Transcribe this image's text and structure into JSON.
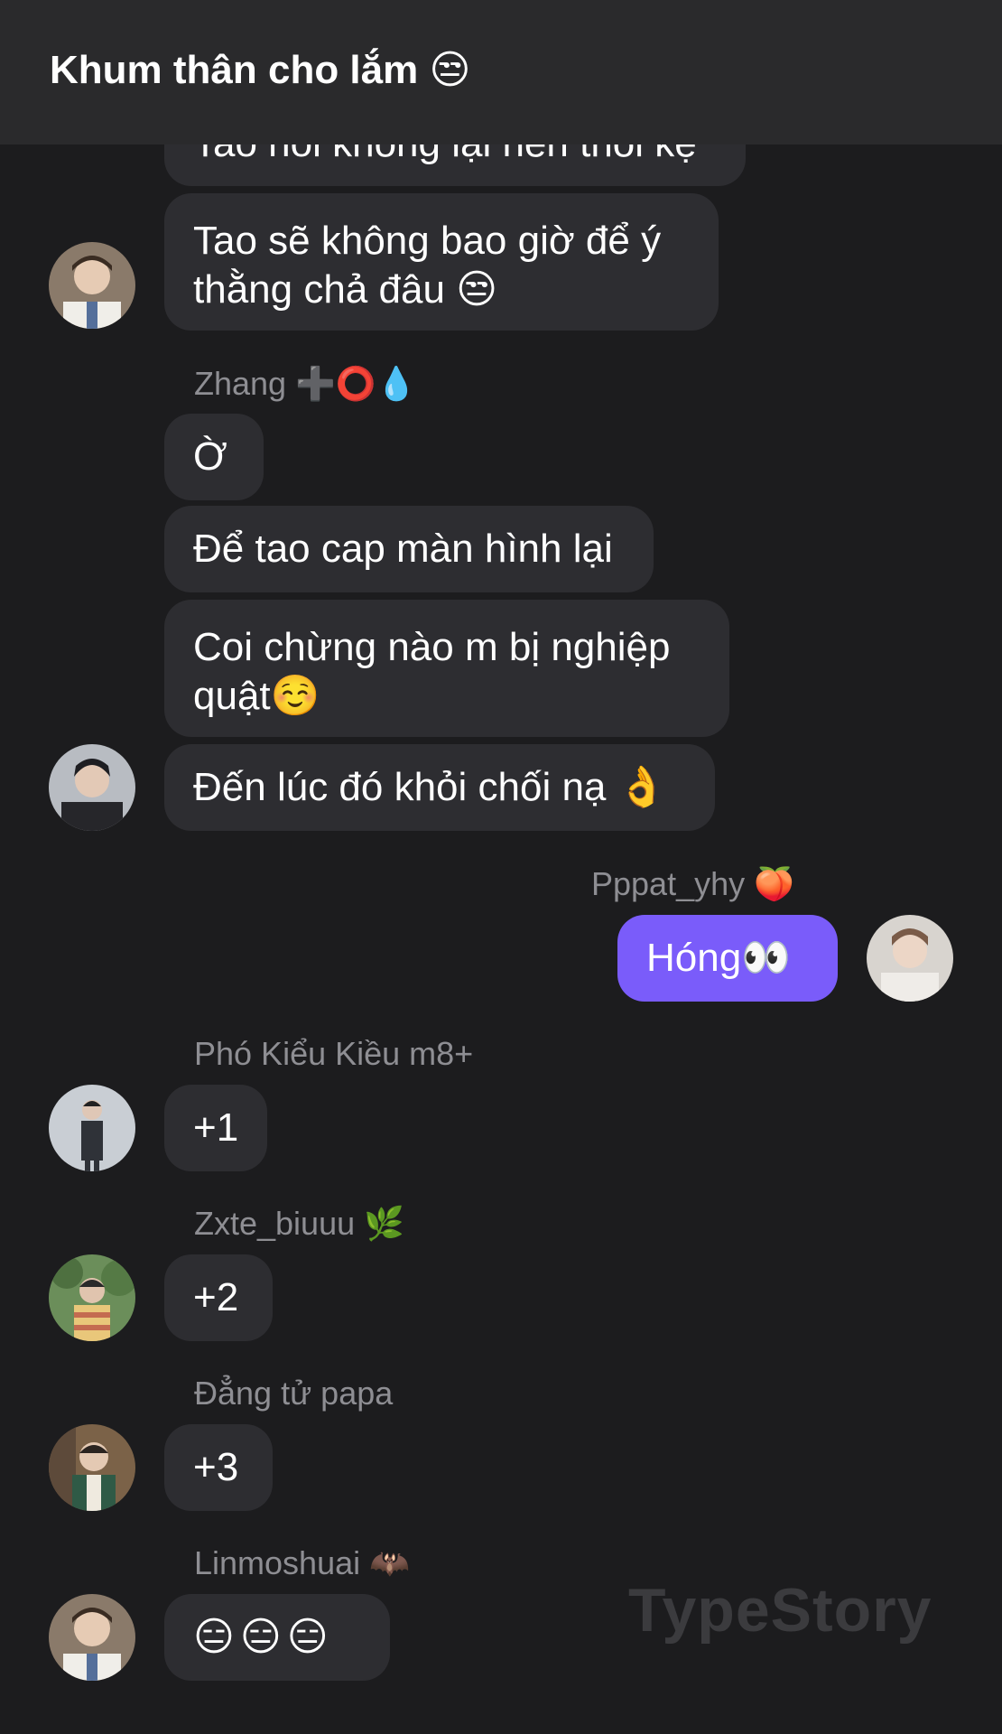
{
  "header": {
    "title": "Khum thân cho lắm 😒"
  },
  "messages": {
    "m0": "Tao nói không lại nên thôi kệ",
    "m1": "Tao sẽ không bao giờ để ý thằng chả đâu 😒",
    "n2": "Zhang ➕⭕💧",
    "m2": "Ờ",
    "m3": "Để tao cap màn hình lại",
    "m4": "Coi chừng nào m bị nghiệp quật☺️",
    "m5": "Đến lúc đó khỏi chối nạ 👌",
    "n6": "Pppat_yhy 🍑",
    "m6": "Hóng👀",
    "n7": "Phó Kiểu Kiều m8+",
    "m7": "+1",
    "n8": "Zxte_biuuu 🌿",
    "m8": "+2",
    "n9": "Đẳng tử papa",
    "m9": "+3",
    "n10": "Linmoshuai 🦇",
    "m10": "😑😑😑"
  },
  "watermark": "TypeStory"
}
